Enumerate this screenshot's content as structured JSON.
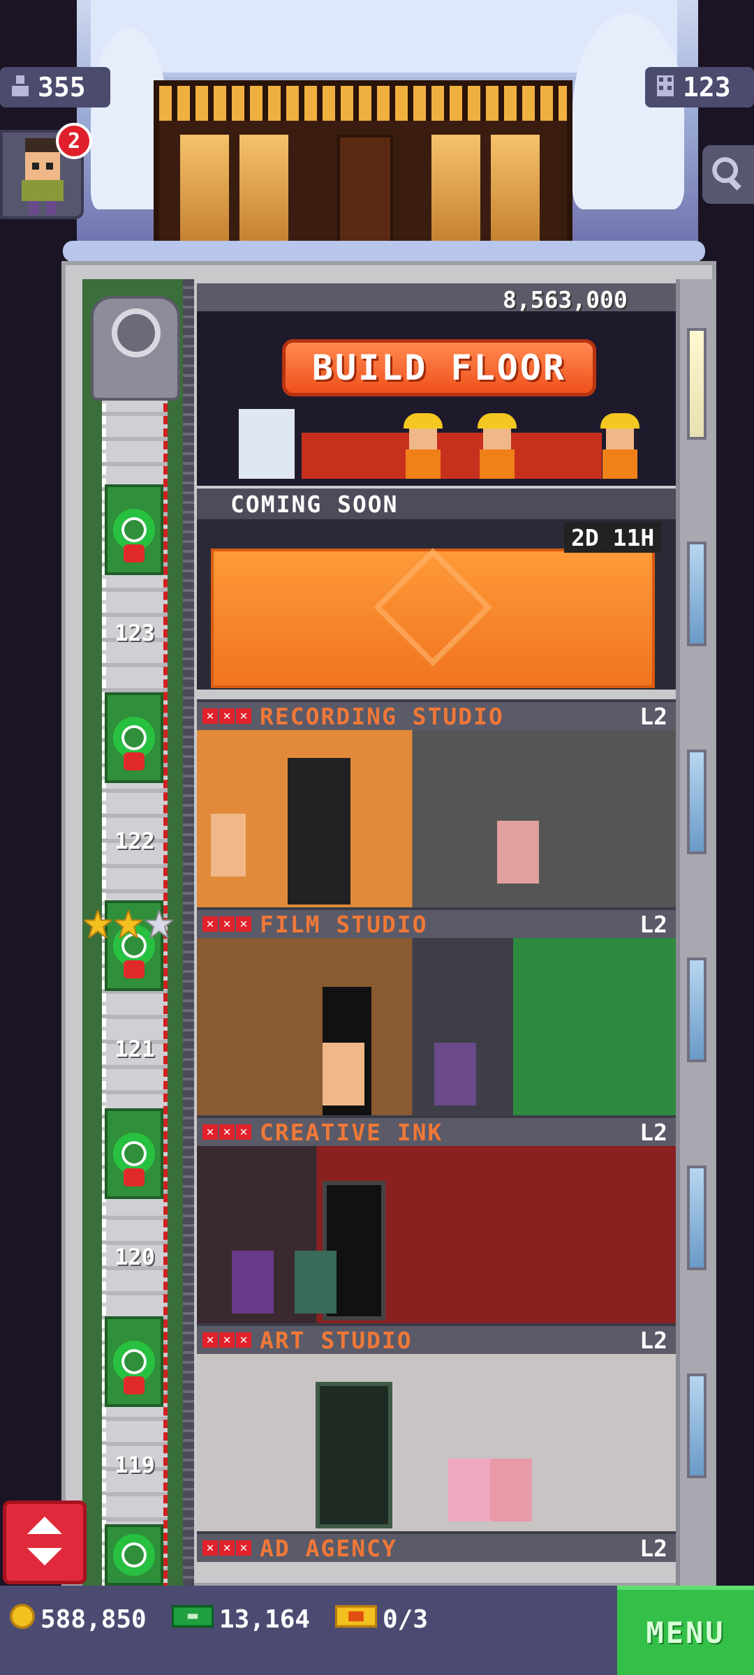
{
  "hud": {
    "population": "355",
    "floors": "123",
    "notifications": "2"
  },
  "build": {
    "cost": "8,563,000",
    "button_label": "BUILD FLOOR"
  },
  "coming_soon": {
    "label": "COMING SOON",
    "timer": "2D 11H"
  },
  "floors": [
    {
      "number": "123",
      "name": "RECORDING STUDIO",
      "level": "L2",
      "stars": 0
    },
    {
      "number": "122",
      "name": "FILM STUDIO",
      "level": "L2",
      "stars": 0
    },
    {
      "number": "121",
      "name": "CREATIVE INK",
      "level": "L2",
      "stars": 0
    },
    {
      "number": "120",
      "name": "ART STUDIO",
      "level": "L2",
      "stars": 0
    },
    {
      "number": "119",
      "name": "AD AGENCY",
      "level": "L2",
      "stars": 0
    }
  ],
  "elevator_stars": {
    "filled": 2,
    "total": 3
  },
  "bottom": {
    "coins": "588,850",
    "bux": "13,164",
    "tickets": "0/3",
    "menu_label": "MENU"
  },
  "colors": {
    "accent_orange": "#f07838",
    "menu_green": "#34c048",
    "elevator_red": "#e02a3c"
  }
}
